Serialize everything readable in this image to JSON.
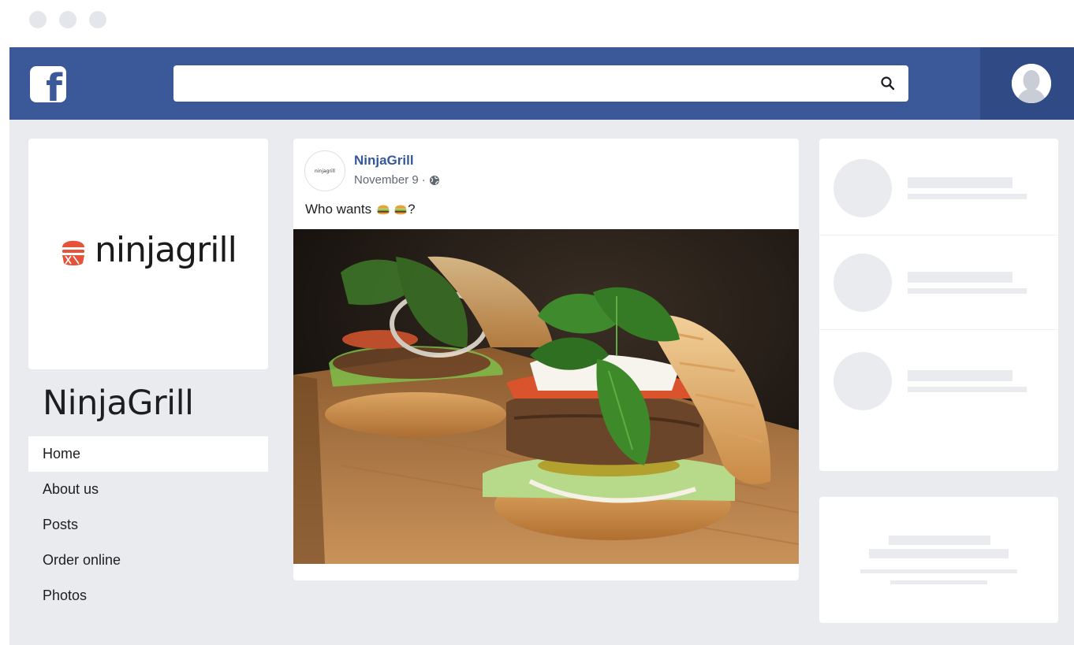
{
  "window": {
    "controls": [
      "close",
      "minimize",
      "maximize"
    ]
  },
  "topbar": {
    "logo_icon": "facebook-f-icon",
    "search": {
      "value": "",
      "placeholder": "",
      "icon": "search-icon"
    },
    "profile_icon": "user-avatar-icon",
    "colors": {
      "bar": "#3b5998",
      "profile_zone": "#2f4a84"
    }
  },
  "page": {
    "logo_text": "ninjagrill",
    "logo_color": "#e4533a",
    "name": "NinjaGrill",
    "nav": [
      {
        "label": "Home",
        "active": true
      },
      {
        "label": "About us",
        "active": false
      },
      {
        "label": "Posts",
        "active": false
      },
      {
        "label": "Order online",
        "active": false
      },
      {
        "label": "Photos",
        "active": false
      }
    ]
  },
  "post": {
    "avatar_text": "ninjagrill",
    "author": "NinjaGrill",
    "date": "November 9",
    "separator": "·",
    "privacy_icon": "globe-icon",
    "text_prefix": "Who wants",
    "text_emojis": [
      "burger-emoji",
      "burger-emoji"
    ],
    "text_suffix": "?",
    "photo": "burgers-on-cutting-board-image"
  },
  "sidebar": {
    "placeholder_rows": 3,
    "placeholder_lines": 4
  }
}
